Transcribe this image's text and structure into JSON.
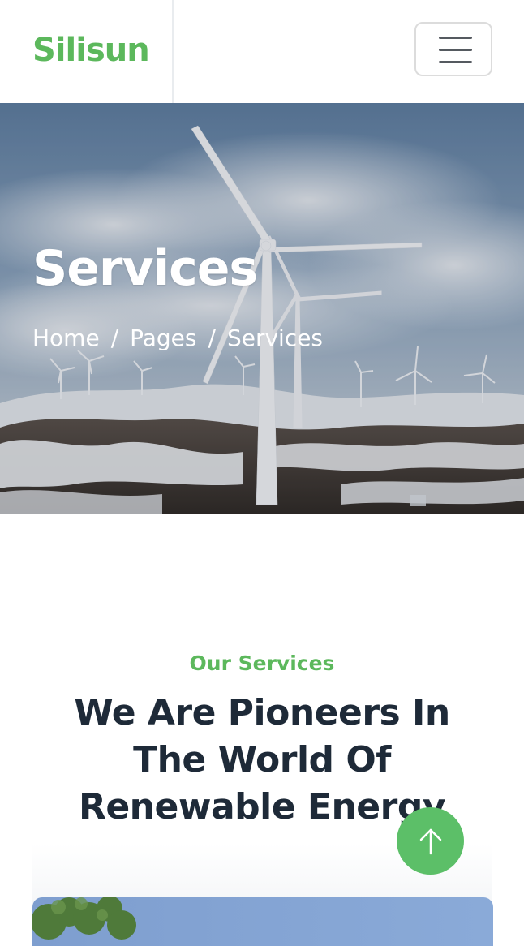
{
  "header": {
    "brand": "Silisun",
    "menu_icon": "hamburger-icon"
  },
  "hero": {
    "title": "Services",
    "breadcrumb": [
      {
        "label": "Home"
      },
      {
        "label": "Pages"
      },
      {
        "label": "Services"
      }
    ],
    "separator": "/"
  },
  "services": {
    "eyebrow": "Our Services",
    "title": "We Are Pioneers In The World Of Renewable Energy"
  },
  "back_to_top": {
    "icon": "arrow-up-icon"
  },
  "colors": {
    "brand": "#5cb85c",
    "heading": "#1e2a38",
    "back_to_top": "#5cbf68"
  }
}
